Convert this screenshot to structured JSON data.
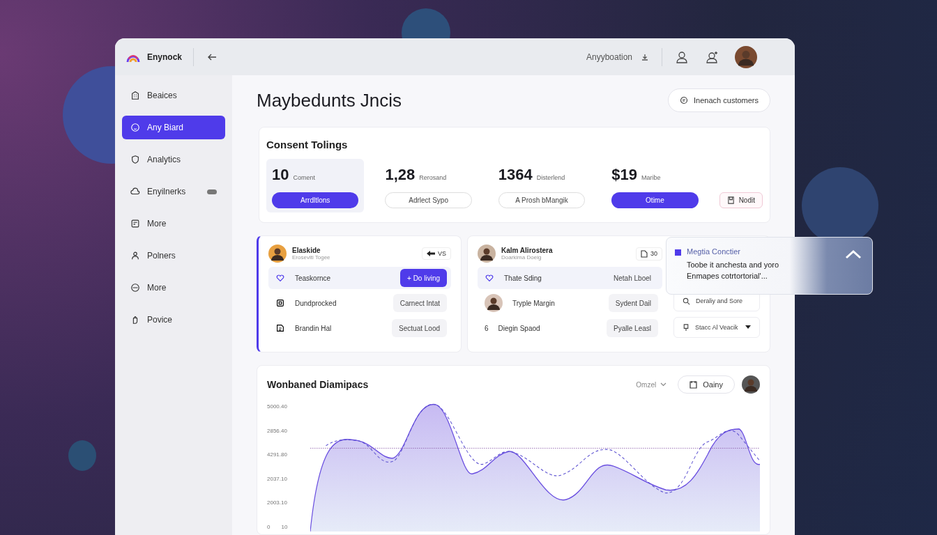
{
  "topbar": {
    "brand": "Enynock",
    "account": "Anyyboation"
  },
  "sidebar": {
    "items": [
      {
        "label": "Beaices",
        "selected": false
      },
      {
        "label": "Any Biard",
        "selected": true
      },
      {
        "label": "Analytics",
        "selected": false
      },
      {
        "label": "Enyilnerks",
        "selected": false,
        "toggle": {
          "on": false
        }
      },
      {
        "label": "More",
        "selected": false
      },
      {
        "label": "Polners",
        "selected": false
      },
      {
        "label": "More",
        "selected": false
      },
      {
        "label": "Povice",
        "selected": false
      }
    ]
  },
  "page": {
    "title": "Maybedunts Jncis",
    "action": "Inenach customers"
  },
  "stats_card": {
    "title": "Consent Tolings",
    "stats": [
      {
        "value": "10",
        "unit": "Coment",
        "button": "Arrdltlons",
        "kind": "primary",
        "selected": true
      },
      {
        "value": "1,28",
        "unit": "Rerosand",
        "button": "Adrlect Sypo",
        "kind": "outline",
        "selected": false
      },
      {
        "value": "1364",
        "unit": "Disterlend",
        "button": "A Prosh bMangik",
        "kind": "outline",
        "selected": false
      },
      {
        "value": "$19",
        "unit": "Maribe",
        "button": "Otime",
        "kind": "primary",
        "selected": false
      }
    ],
    "extra_button": "Nodit"
  },
  "person_cards": [
    {
      "name": "Elaskide",
      "subtitle": "Eroseviti Togee",
      "badge": "VS",
      "selected": true,
      "rows": [
        {
          "label": "Teaskornce",
          "button": {
            "label": "+ Do living",
            "kind": "primary"
          },
          "selected": true
        },
        {
          "label": "Dundprocked",
          "button": {
            "label": "Carnect Intat",
            "kind": "soft"
          },
          "selected": false
        },
        {
          "label": "Brandin Hal",
          "button": {
            "label": "Sectuat Lood",
            "kind": "soft"
          },
          "selected": false
        }
      ]
    },
    {
      "name": "Kalm Alirostera",
      "subtitle": "Doarkima Doeig",
      "badge": "30",
      "selected": false,
      "rows": [
        {
          "kind": "icon",
          "label": "Thate Sding",
          "button": {
            "label": "Netah Lboel",
            "kind": "plain"
          },
          "selected": true
        },
        {
          "kind": "avatar",
          "label": "Tryple Margin",
          "button": {
            "label": "Sydent Dail",
            "kind": "soft"
          },
          "selected": false
        },
        {
          "kind": "number",
          "number": "6",
          "label": "Diegin Spaod",
          "button": {
            "label": "Pyalle Leasl",
            "kind": "soft"
          },
          "selected": false
        }
      ],
      "side_buttons": [
        {
          "label": "Deraliy and Sore",
          "kind": "search"
        },
        {
          "label": "Stacc Al Veacik",
          "kind": "dropdown"
        }
      ]
    }
  ],
  "popover": {
    "title": "Megtia Conctier",
    "color": "#4f3bea",
    "text": "Toobe it anchesta and yoro Enmapes cotrtortorial'..."
  },
  "chart_card": {
    "title": "Wonbaned Diamipacs",
    "filter": "Omzel",
    "button": "Oainy",
    "y_labels": [
      "5000.40",
      "2856.40",
      "4291.80",
      "2037.10",
      "2003.10",
      "0"
    ],
    "x_start": "10"
  }
}
